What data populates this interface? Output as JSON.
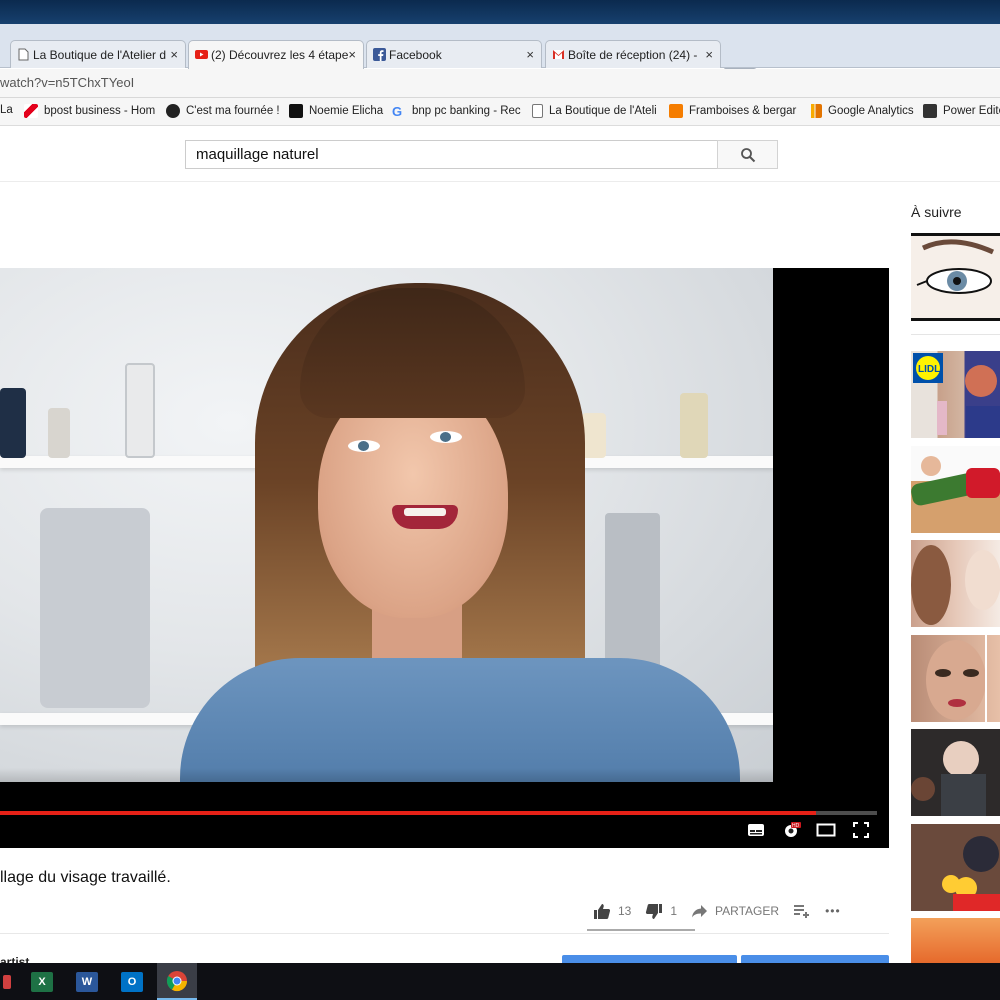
{
  "browser": {
    "tabs": [
      {
        "title": "La Boutique de l'Atelier d",
        "close": "×",
        "favicon": "page-icon",
        "active": false
      },
      {
        "title": "(2) Découvrez les 4 étape",
        "close": "×",
        "favicon": "youtube-icon",
        "active": true
      },
      {
        "title": "Facebook",
        "close": "×",
        "favicon": "facebook-icon",
        "active": false
      },
      {
        "title": "Boîte de réception (24) - ",
        "close": "×",
        "favicon": "gmail-icon",
        "active": false
      }
    ],
    "address": "watch?v=n5TChxTYeoI",
    "bookmarks": [
      {
        "label": "La",
        "icon": "bookmark-icon"
      },
      {
        "label": "bpost business - Hom",
        "icon": "bpost-icon"
      },
      {
        "label": "C'est ma fournée !",
        "icon": "fournee-icon"
      },
      {
        "label": "Noemie Elicha",
        "icon": "skull-icon"
      },
      {
        "label": "bnp pc banking - Rec",
        "icon": "google-icon"
      },
      {
        "label": "La Boutique de l'Ateli",
        "icon": "page-icon"
      },
      {
        "label": "Framboises & bergar",
        "icon": "blogger-icon"
      },
      {
        "label": "Google Analytics",
        "icon": "analytics-icon"
      },
      {
        "label": "Power Edito",
        "icon": "power-editor-icon"
      }
    ]
  },
  "youtube": {
    "search_value": "maquillage naturel",
    "player": {
      "progress": 0.93
    },
    "video_title": "llage du visage travaillé.",
    "likes": "13",
    "dislikes": "1",
    "share_label": "PARTAGER",
    "more_label": "•••",
    "channel": "artist",
    "up_next_label": "À suivre",
    "colors": {
      "progress": "#e62117",
      "accent_button": "#4a8ee8",
      "dislike_red": "#cc181e"
    }
  },
  "taskbar": {
    "apps": [
      {
        "name": "excel",
        "label": "X"
      },
      {
        "name": "word",
        "label": "W"
      },
      {
        "name": "outlook",
        "label": "O"
      },
      {
        "name": "chrome",
        "label": ""
      }
    ]
  }
}
